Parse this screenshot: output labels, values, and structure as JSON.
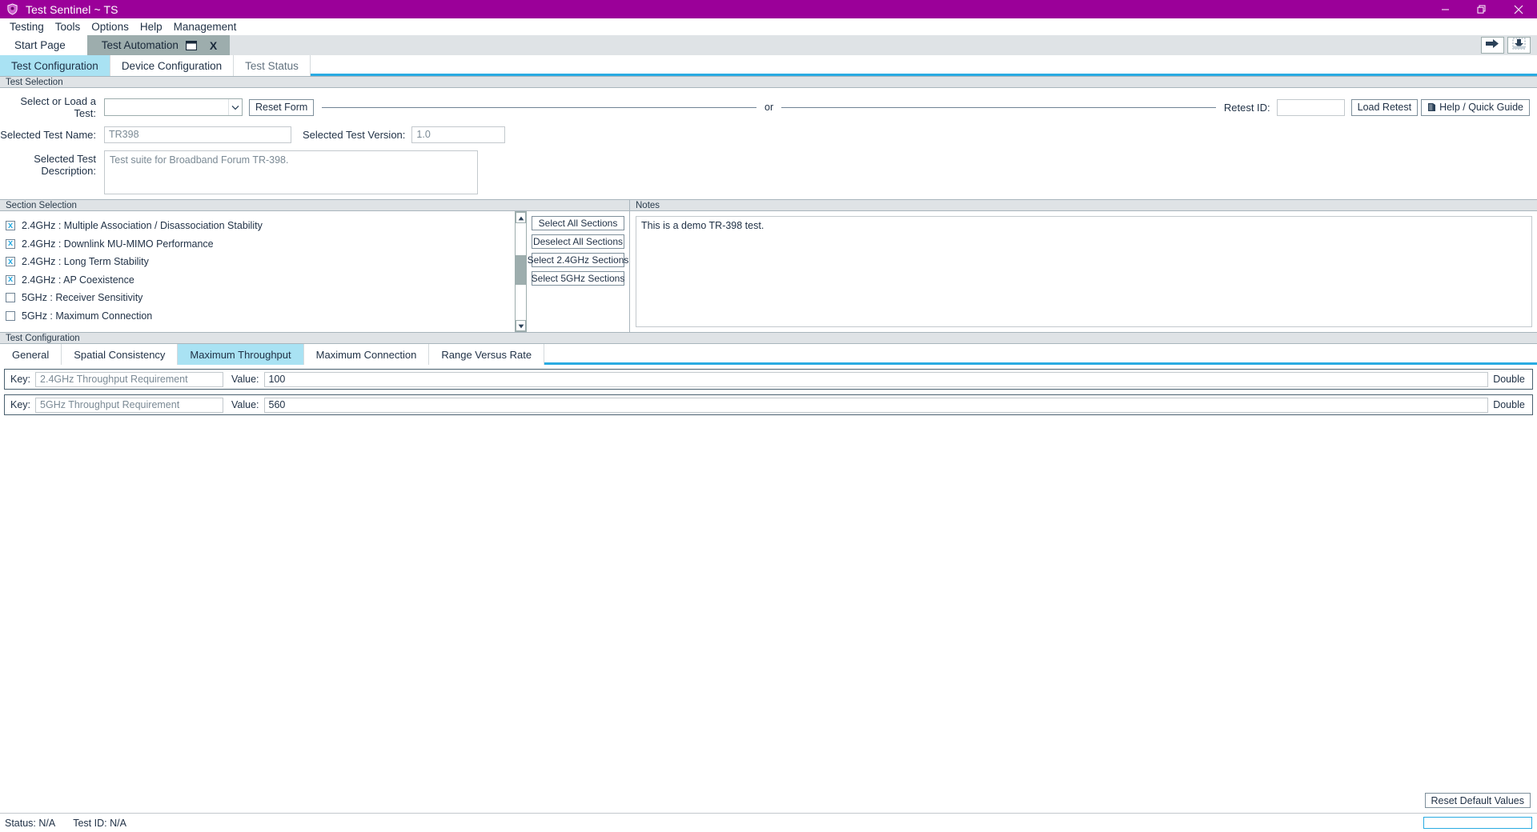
{
  "window": {
    "title": "Test Sentinel ~ TS",
    "icon": "shield-icon",
    "titlebar_color": "#9b0099",
    "minimize_label": "—",
    "maximize_label": "❐",
    "close_label": "✕"
  },
  "menu": {
    "items": [
      {
        "label": "Testing"
      },
      {
        "label": "Tools"
      },
      {
        "label": "Options"
      },
      {
        "label": "Help"
      },
      {
        "label": "Management"
      }
    ]
  },
  "doc_tabs": {
    "tabs": [
      {
        "label": "Start Page",
        "active": false
      },
      {
        "label": "Test Automation",
        "active": true,
        "close_label": "X",
        "icon": "window-restore-icon"
      }
    ],
    "toolbar": [
      {
        "name": "run-next-button",
        "icon": "arrow-right-icon"
      },
      {
        "name": "save-download-button",
        "icon": "arrow-down-tray-icon"
      }
    ]
  },
  "page_tabs": [
    {
      "label": "Test Configuration",
      "active": true
    },
    {
      "label": "Device Configuration",
      "active": false
    },
    {
      "label": "Test Status",
      "active": false
    }
  ],
  "test_selection": {
    "group_title": "Test Selection",
    "select_or_load_label": "Select or Load a Test:",
    "select_or_load_value": "",
    "select_or_load_placeholder": "",
    "reset_form_label": "Reset Form",
    "or_label": "or",
    "retest_id_label": "Retest ID:",
    "retest_id_value": "",
    "load_retest_label": "Load Retest",
    "help_quick_guide_label": "Help / Quick Guide",
    "help_icon": "book-icon",
    "selected_test_name_label": "Selected Test Name:",
    "selected_test_name_value": "TR398",
    "selected_test_version_label": "Selected Test Version:",
    "selected_test_version_value": "1.0",
    "selected_test_description_label": "Selected Test Description:",
    "selected_test_description_value": "Test suite for Broadband Forum TR-398."
  },
  "section_selection": {
    "group_title": "Section Selection",
    "sections": [
      {
        "label": "2.4GHz : Multiple Association / Disassociation Stability",
        "checked": true
      },
      {
        "label": "2.4GHz : Downlink MU-MIMO Performance",
        "checked": true
      },
      {
        "label": "2.4GHz : Long Term Stability",
        "checked": true
      },
      {
        "label": "2.4GHz : AP Coexistence",
        "checked": true
      },
      {
        "label": "5GHz : Receiver Sensitivity",
        "checked": false
      },
      {
        "label": "5GHz : Maximum Connection",
        "checked": false
      }
    ],
    "checked_glyph": "x",
    "buttons": [
      {
        "label": "Select All Sections"
      },
      {
        "label": "Deselect All Sections"
      },
      {
        "label": "Select 2.4GHz Sections"
      },
      {
        "label": "Select 5GHz Sections"
      }
    ],
    "scroll_up_icon": "triangle-up-icon",
    "scroll_down_icon": "triangle-down-icon"
  },
  "notes": {
    "group_title": "Notes",
    "value": "This is a demo TR-398 test."
  },
  "test_configuration": {
    "group_title": "Test Configuration",
    "tabs": [
      {
        "label": "General",
        "active": false
      },
      {
        "label": "Spatial Consistency",
        "active": false
      },
      {
        "label": "Maximum Throughput",
        "active": true
      },
      {
        "label": "Maximum Connection",
        "active": false
      },
      {
        "label": "Range Versus Rate",
        "active": false
      }
    ],
    "key_label": "Key:",
    "value_label": "Value:",
    "rows": [
      {
        "key": "2.4GHz Throughput Requirement",
        "value": "100",
        "type": "Double"
      },
      {
        "key": "5GHz Throughput Requirement",
        "value": "560",
        "type": "Double"
      }
    ],
    "reset_defaults_label": "Reset Default Values"
  },
  "status_bar": {
    "status_text": "Status: N/A",
    "test_id_text": "Test ID: N/A",
    "progress_value": "",
    "progress_color": "#29abe2"
  }
}
